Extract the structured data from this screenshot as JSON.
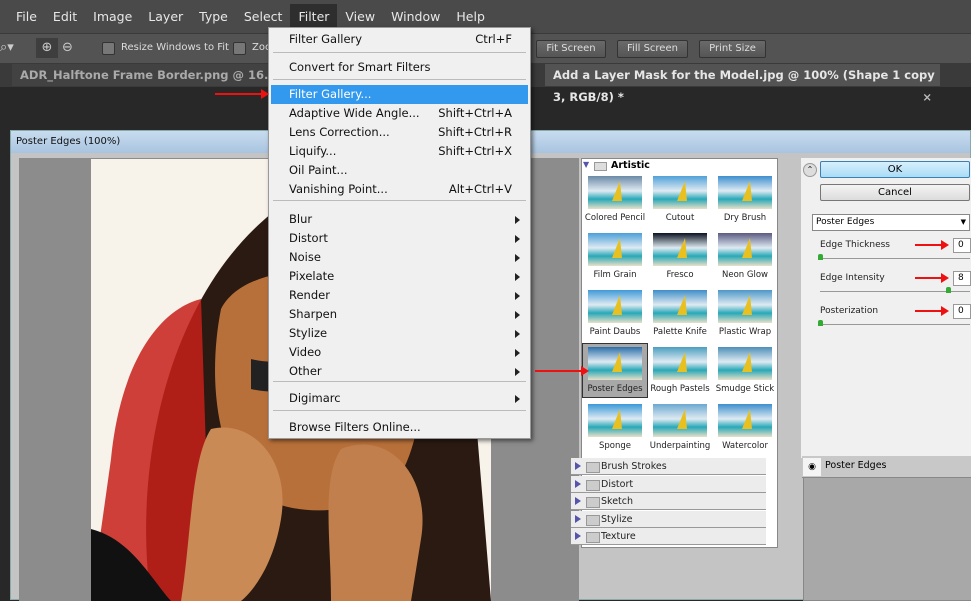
{
  "menubar": [
    "File",
    "Edit",
    "Image",
    "Layer",
    "Type",
    "Select",
    "Filter",
    "View",
    "Window",
    "Help"
  ],
  "toolbar": {
    "resize_label": "Resize Windows to Fit",
    "zoom_label": "Zoo",
    "fit_screen": "Fit Screen",
    "fill_screen": "Fill Screen",
    "print_size": "Print Size"
  },
  "tabs": [
    {
      "label": "ADR_Halftone Frame Border.png @ 16.7% (..."
    },
    {
      "label": "Add a Layer Mask for the Model.jpg @ 100% (Shape 1 copy 3, RGB/8) *"
    }
  ],
  "dialog": {
    "title": "Poster Edges (100%)",
    "filters": {
      "category": "Artistic",
      "items": [
        "Colored Pencil",
        "Cutout",
        "Dry Brush",
        "Film Grain",
        "Fresco",
        "Neon Glow",
        "Paint Daubs",
        "Palette Knife",
        "Plastic Wrap",
        "Poster Edges",
        "Rough Pastels",
        "Smudge Stick",
        "Sponge",
        "Underpainting",
        "Watercolor"
      ],
      "selected": "Poster Edges",
      "categories": [
        "Brush Strokes",
        "Distort",
        "Sketch",
        "Stylize",
        "Texture"
      ]
    },
    "ok": "OK",
    "cancel": "Cancel",
    "filter_select": "Poster Edges",
    "params": [
      {
        "label": "Edge Thickness",
        "value": "0",
        "fraction": 0
      },
      {
        "label": "Edge Intensity",
        "value": "8",
        "fraction": 0.8
      },
      {
        "label": "Posterization",
        "value": "0",
        "fraction": 0
      }
    ],
    "layer": "Poster Edges"
  },
  "menu": {
    "items": [
      {
        "label": "Filter Gallery",
        "shortcut": "Ctrl+F"
      },
      {
        "label": "Convert for Smart Filters"
      },
      {
        "label": "Filter Gallery...",
        "highlighted": true
      },
      {
        "label": "Adaptive Wide Angle...",
        "shortcut": "Shift+Ctrl+A"
      },
      {
        "label": "Lens Correction...",
        "shortcut": "Shift+Ctrl+R"
      },
      {
        "label": "Liquify...",
        "shortcut": "Shift+Ctrl+X"
      },
      {
        "label": "Oil Paint..."
      },
      {
        "label": "Vanishing Point...",
        "shortcut": "Alt+Ctrl+V"
      },
      {
        "label": "Blur",
        "submenu": true
      },
      {
        "label": "Distort",
        "submenu": true
      },
      {
        "label": "Noise",
        "submenu": true
      },
      {
        "label": "Pixelate",
        "submenu": true
      },
      {
        "label": "Render",
        "submenu": true
      },
      {
        "label": "Sharpen",
        "submenu": true
      },
      {
        "label": "Stylize",
        "submenu": true
      },
      {
        "label": "Video",
        "submenu": true
      },
      {
        "label": "Other",
        "submenu": true
      },
      {
        "label": "Digimarc",
        "submenu": true
      },
      {
        "label": "Browse Filters Online..."
      }
    ]
  },
  "colors": {
    "highlight": "#3399ee",
    "arrow": "#e11111",
    "ok_button": "#bfe6fb"
  }
}
